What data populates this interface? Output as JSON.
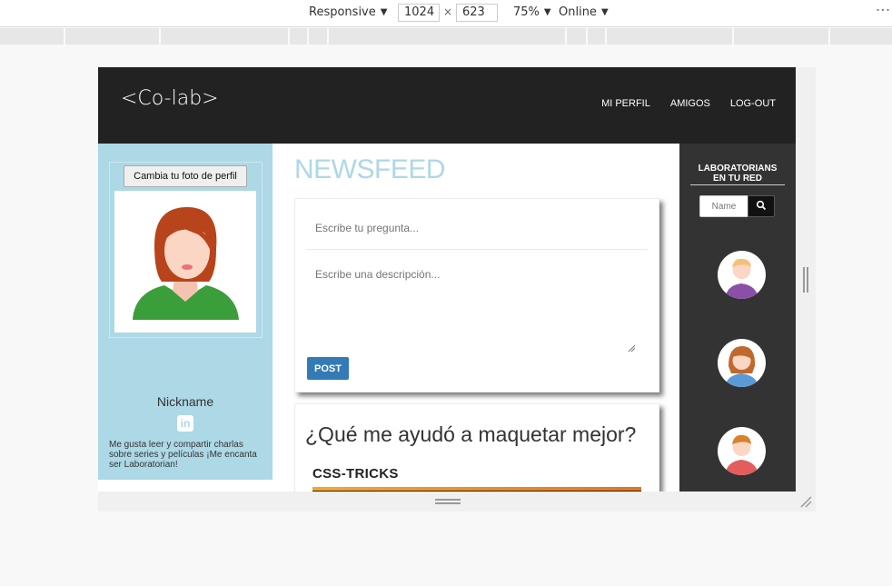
{
  "devtools": {
    "device": "Responsive",
    "width": "1024",
    "times": "×",
    "height": "623",
    "zoom": "75%",
    "network": "Online"
  },
  "header": {
    "logo": "<Co-lab>",
    "nav": [
      "MI PERFIL",
      "AMIGOS",
      "LOG-OUT"
    ]
  },
  "profile": {
    "change_photo": "Cambia tu foto de perfil",
    "nickname": "Nickname",
    "linkedin": "in",
    "bio": "Me gusta leer y compartir charlas sobre series y películas ¡Me encanta ser Laboratorian!"
  },
  "feed": {
    "title": "NEWSFEED",
    "question_placeholder": "Escribe tu pregunta...",
    "description_placeholder": "Escribe una descripción...",
    "post_label": "POST",
    "article_title": "¿Qué me ayudó a maquetar mejor?",
    "article_brand": "CSS-TRICKS"
  },
  "sidebar": {
    "title_line1": "LABORATORIANS",
    "title_line2": "EN TU RED",
    "search_placeholder": "Name",
    "friends": [
      "friend-1",
      "friend-2",
      "friend-3"
    ]
  },
  "colors": {
    "accent": "#add8e6",
    "header": "#222222",
    "sidebar": "#333333",
    "button": "#337ab7"
  }
}
